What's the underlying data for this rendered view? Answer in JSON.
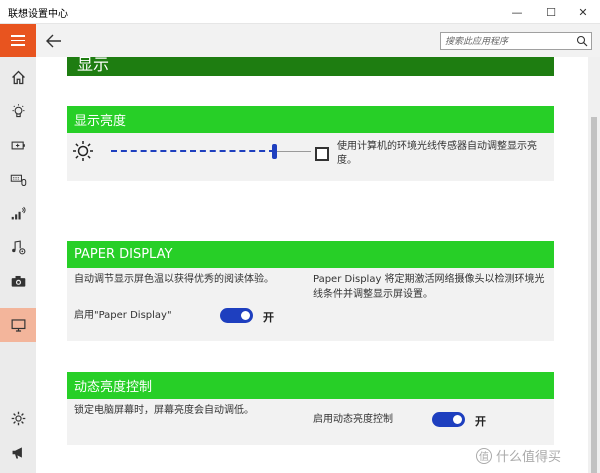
{
  "window": {
    "title": "联想设置中心",
    "minimize": "—",
    "maximize": "☐",
    "close": "✕"
  },
  "search": {
    "placeholder": "搜索此应用程序"
  },
  "section_top": {
    "title": "显示"
  },
  "brightness": {
    "title": "显示亮度",
    "slider_value_fraction": 0.82,
    "auto_label": "使用计算机的环境光线传感器自动调整显示亮度。"
  },
  "paper_display": {
    "title": "PAPER DISPLAY",
    "desc_left": "自动调节显示屏色温以获得优秀的阅读体验。",
    "desc_right": "Paper Display 将定期激活网络摄像头以检测环境光线条件并调整显示屏设置。",
    "toggle_label": "启用\"Paper Display\"",
    "toggle_state": "开"
  },
  "dynamic_brightness": {
    "title": "动态亮度控制",
    "desc_left": "锁定电脑屏幕时，屏幕亮度会自动调低。",
    "toggle_label": "启用动态亮度控制",
    "toggle_state": "开"
  },
  "watermark": {
    "text": "什么值得买",
    "icon_char": "值"
  },
  "colors": {
    "accent_orange": "#e8541f",
    "card_header_green": "#27cf27",
    "section_dark_green": "#1e7d11",
    "toggle_blue": "#1e3fbf",
    "active_nav": "#f3b59b"
  }
}
